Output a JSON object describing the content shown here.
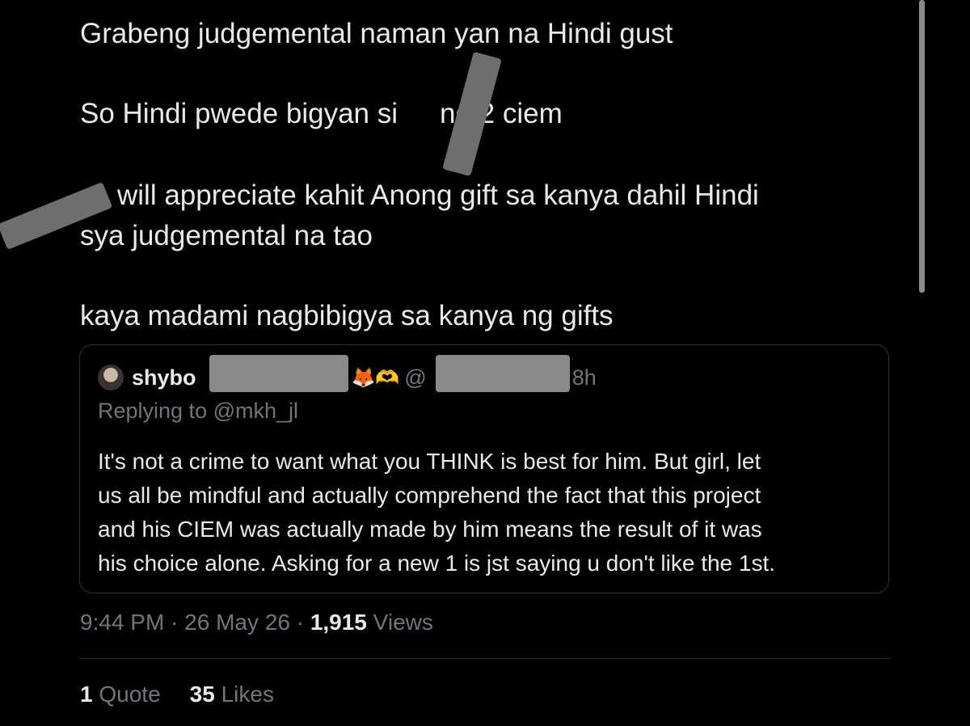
{
  "tweet": {
    "lines": [
      "Grabeng judgemental naman yan na Hindi gust",
      "So Hindi pwede bigyan si",
      "ng 2 ciem",
      "will appreciate kahit Anong gift sa kanya dahil Hindi",
      "sya judgemental na tao",
      "kaya madami nagbibigya sa kanya ng gifts"
    ]
  },
  "quote": {
    "name": "shybo",
    "emoji": "🦊🫶",
    "handle_prefix": "@",
    "time": "8h",
    "replying_to": "Replying to @mkh_jl",
    "body_lines": [
      "It's not a crime to want what you THINK is best for him. But girl, let",
      "us all be mindful and actually comprehend the fact that this project",
      "and his CIEM was actually made by him means the result of it was",
      "his choice alone. Asking for a new 1 is jst saying u don't like the 1st."
    ]
  },
  "meta": {
    "time": "9:44 PM",
    "sep": " · ",
    "date": "26 May 26",
    "views_count": "1,915",
    "views_label": "Views"
  },
  "stats": {
    "quotes_count": "1",
    "quotes_label": "Quote",
    "likes_count": "35",
    "likes_label": "Likes"
  },
  "colors": {
    "background": "#000000",
    "text": "#e7e9ea",
    "secondary": "#71767b",
    "border": "#2f3336"
  }
}
